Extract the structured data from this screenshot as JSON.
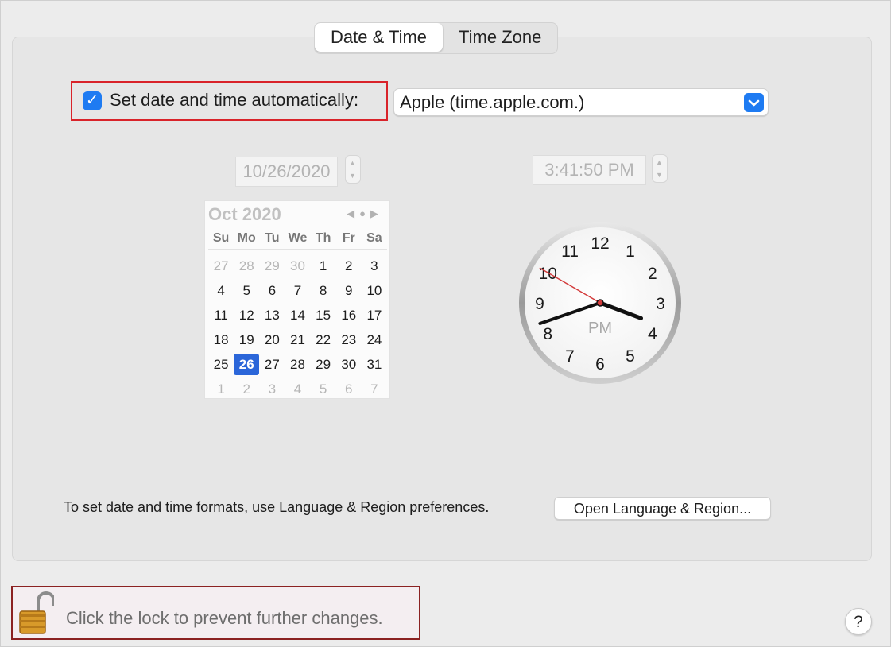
{
  "tabs": [
    {
      "label": "Date & Time",
      "active": true
    },
    {
      "label": "Time Zone",
      "active": false
    }
  ],
  "auto": {
    "label": "Set date and time automatically:",
    "checked": true
  },
  "server": {
    "value": "Apple (time.apple.com.)"
  },
  "date_field": {
    "value": "10/26/2020"
  },
  "time_field": {
    "value": "3:41:50 PM"
  },
  "calendar": {
    "title": "Oct 2020",
    "weekdays": [
      "Su",
      "Mo",
      "Tu",
      "We",
      "Th",
      "Fr",
      "Sa"
    ],
    "days": [
      {
        "d": "27",
        "out": true
      },
      {
        "d": "28",
        "out": true
      },
      {
        "d": "29",
        "out": true
      },
      {
        "d": "30",
        "out": true
      },
      {
        "d": "1"
      },
      {
        "d": "2"
      },
      {
        "d": "3"
      },
      {
        "d": "4"
      },
      {
        "d": "5"
      },
      {
        "d": "6"
      },
      {
        "d": "7"
      },
      {
        "d": "8"
      },
      {
        "d": "9"
      },
      {
        "d": "10"
      },
      {
        "d": "11"
      },
      {
        "d": "12"
      },
      {
        "d": "13"
      },
      {
        "d": "14"
      },
      {
        "d": "15"
      },
      {
        "d": "16"
      },
      {
        "d": "17"
      },
      {
        "d": "18"
      },
      {
        "d": "19"
      },
      {
        "d": "20"
      },
      {
        "d": "21"
      },
      {
        "d": "22"
      },
      {
        "d": "23"
      },
      {
        "d": "24"
      },
      {
        "d": "25"
      },
      {
        "d": "26",
        "selected": true
      },
      {
        "d": "27"
      },
      {
        "d": "28"
      },
      {
        "d": "29"
      },
      {
        "d": "30"
      },
      {
        "d": "31"
      },
      {
        "d": "1",
        "out": true
      },
      {
        "d": "2",
        "out": true
      },
      {
        "d": "3",
        "out": true
      },
      {
        "d": "4",
        "out": true
      },
      {
        "d": "5",
        "out": true
      },
      {
        "d": "6",
        "out": true
      },
      {
        "d": "7",
        "out": true
      }
    ]
  },
  "clock": {
    "numbers": [
      "12",
      "1",
      "2",
      "3",
      "4",
      "5",
      "6",
      "7",
      "8",
      "9",
      "10",
      "11"
    ],
    "period": "PM",
    "hour": 3,
    "minute": 41,
    "second": 50
  },
  "formats": {
    "text": "To set date and time formats, use Language & Region preferences.",
    "button": "Open Language & Region..."
  },
  "lock": {
    "text": "Click the lock to prevent further changes."
  },
  "help": {
    "label": "?"
  },
  "colors": {
    "accent": "#1e7bf2",
    "highlight_red": "#d9232a",
    "lock_border": "#8b2222",
    "second_hand": "#d33b3b"
  }
}
